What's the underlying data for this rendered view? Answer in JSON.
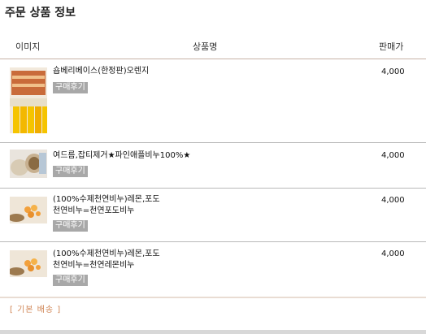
{
  "title": "주문 상품 정보",
  "headers": {
    "image": "이미지",
    "name": "상품명",
    "price": "판매가"
  },
  "items": [
    {
      "name": "숍베리베이스(한정판)오렌지",
      "review": "구매후기",
      "price": "4,000"
    },
    {
      "name": "여드름,잡티제거★파인애플비누100%★",
      "review": "구매후기",
      "price": "4,000"
    },
    {
      "name": "(100%수제천연비누)레몬,포도\n천연비누=천연포도비누",
      "review": "구매후기",
      "price": "4,000"
    },
    {
      "name": "(100%수제천연비누)레몬,포도\n천연비누=천연레몬비누",
      "review": "구매후기",
      "price": "4,000"
    }
  ],
  "shipping_label": "[ 기본 배송 ]"
}
